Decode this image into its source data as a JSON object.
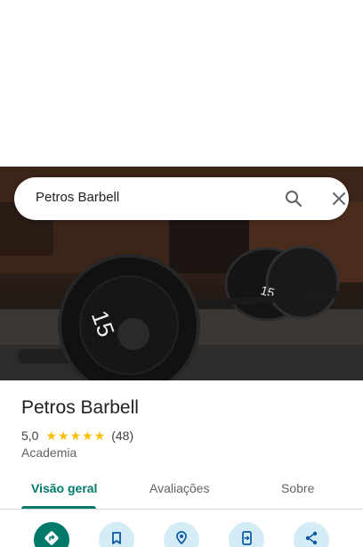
{
  "search": {
    "query": "Petros Barbell"
  },
  "place": {
    "name": "Petros Barbell",
    "rating": "5,0",
    "stars": "★★★★★",
    "review_count": "(48)",
    "category": "Academia"
  },
  "tabs": [
    {
      "label": "Visão geral",
      "active": true
    },
    {
      "label": "Avaliações",
      "active": false
    },
    {
      "label": "Sobre",
      "active": false
    }
  ],
  "actions": [
    {
      "icon": "directions-icon"
    },
    {
      "icon": "bookmark-icon"
    },
    {
      "icon": "nearby-icon"
    },
    {
      "icon": "send-to-phone-icon"
    },
    {
      "icon": "share-icon"
    }
  ],
  "colors": {
    "accent": "#00796b",
    "star": "#fbbc04",
    "action_bg": "#d3ecf5"
  }
}
